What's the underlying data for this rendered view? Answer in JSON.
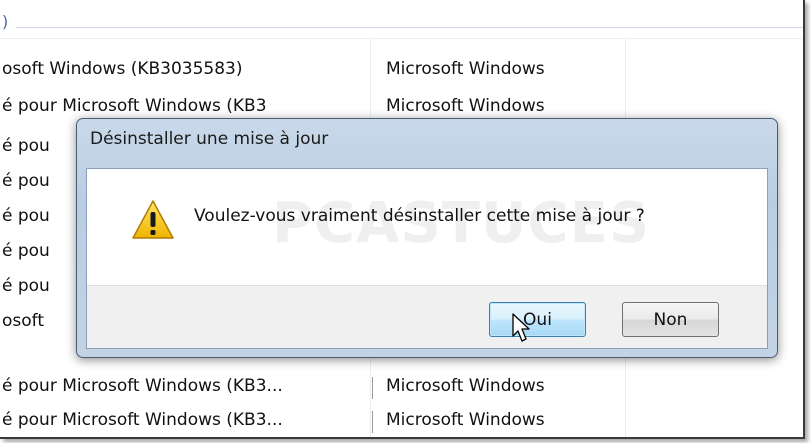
{
  "list": {
    "header_fragment": ")",
    "rows": [
      {
        "name": "osoft Windows (KB3035583)",
        "publisher": "Microsoft Windows"
      },
      {
        "name": "é pour Microsoft Windows (KB3",
        "publisher": "Microsoft Windows"
      },
      {
        "name": "é pou",
        "publisher": ""
      },
      {
        "name": "é pou",
        "publisher": ""
      },
      {
        "name": "é pou",
        "publisher": ""
      },
      {
        "name": "é pou",
        "publisher": ""
      },
      {
        "name": "é pou",
        "publisher": ""
      },
      {
        "name": "osoft",
        "publisher": ""
      },
      {
        "name": "é pour Microsoft Windows (KB3...",
        "publisher": "Microsoft Windows"
      },
      {
        "name": "é pour Microsoft Windows (KB3...",
        "publisher": "Microsoft Windows"
      }
    ]
  },
  "dialog": {
    "title": "Désinstaller une mise à jour",
    "message": "Voulez-vous vraiment désinstaller cette mise à jour ?",
    "icon": "warning-icon",
    "buttons": {
      "yes_label": "Oui",
      "no_label": "Non"
    }
  },
  "watermark": "PCASTUCES",
  "colors": {
    "dialog_frame": "#b9cde2",
    "button_focus": "#3c7fb1",
    "warning_yellow": "#f5c400"
  }
}
